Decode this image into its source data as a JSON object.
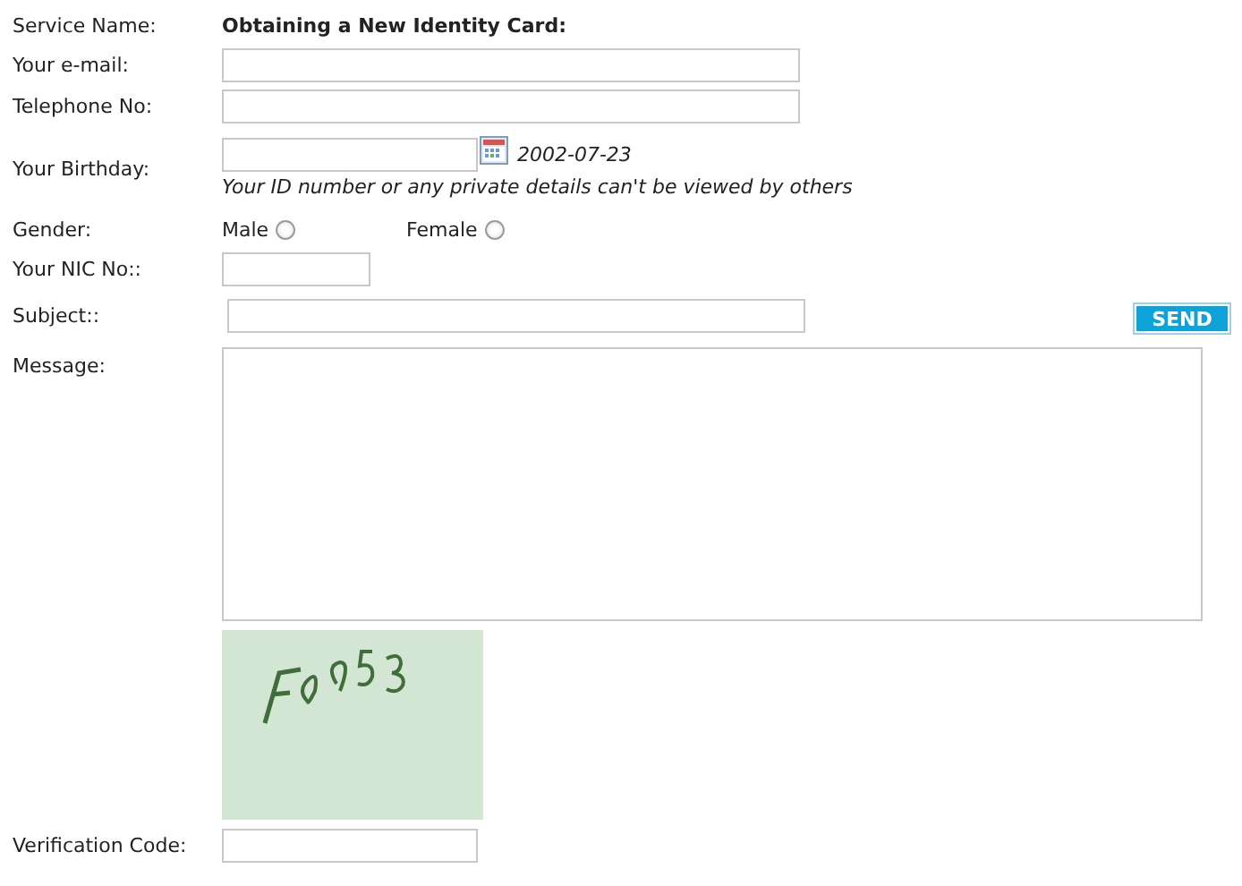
{
  "service": {
    "label": "Service Name:",
    "value": "Obtaining a New Identity Card:"
  },
  "email": {
    "label": "Your e-mail:"
  },
  "telephone": {
    "label": "Telephone No:"
  },
  "birthday": {
    "label": "Your Birthday:",
    "date": "2002-07-23",
    "note": "Your ID number or any private details can't be viewed by others"
  },
  "gender": {
    "label": "Gender:",
    "options": [
      {
        "label": "Male",
        "selected": false
      },
      {
        "label": "Female",
        "selected": false
      }
    ]
  },
  "nic": {
    "label": "Your NIC No::"
  },
  "subject": {
    "label": "Subject::"
  },
  "send_button": "SEND",
  "message": {
    "label": "Message:"
  },
  "verification": {
    "label": "Verification Code:"
  }
}
